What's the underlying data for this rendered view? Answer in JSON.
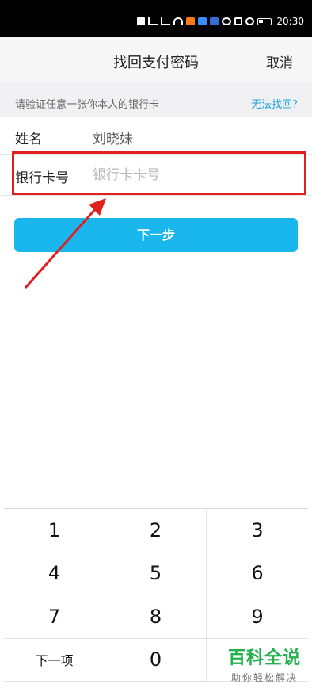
{
  "statusbar": {
    "time": "20:30"
  },
  "nav": {
    "title": "找回支付密码",
    "cancel": "取消"
  },
  "hint": {
    "text": "请验证任意一张你本人的银行卡",
    "link": "无法找回?"
  },
  "form": {
    "name_label": "姓名",
    "name_value": "刘晓妹",
    "card_label": "银行卡号",
    "card_placeholder": "银行卡卡号"
  },
  "next_button": "下一步",
  "keyboard": {
    "keys": [
      "1",
      "2",
      "3",
      "4",
      "5",
      "6",
      "7",
      "8",
      "9",
      "下一项",
      "0",
      ""
    ]
  },
  "watermark": {
    "title": "百科全说",
    "sub": "助你轻松解决"
  },
  "colors": {
    "accent": "#19b7ee",
    "highlight": "#e02020",
    "link": "#1aa3d9"
  }
}
